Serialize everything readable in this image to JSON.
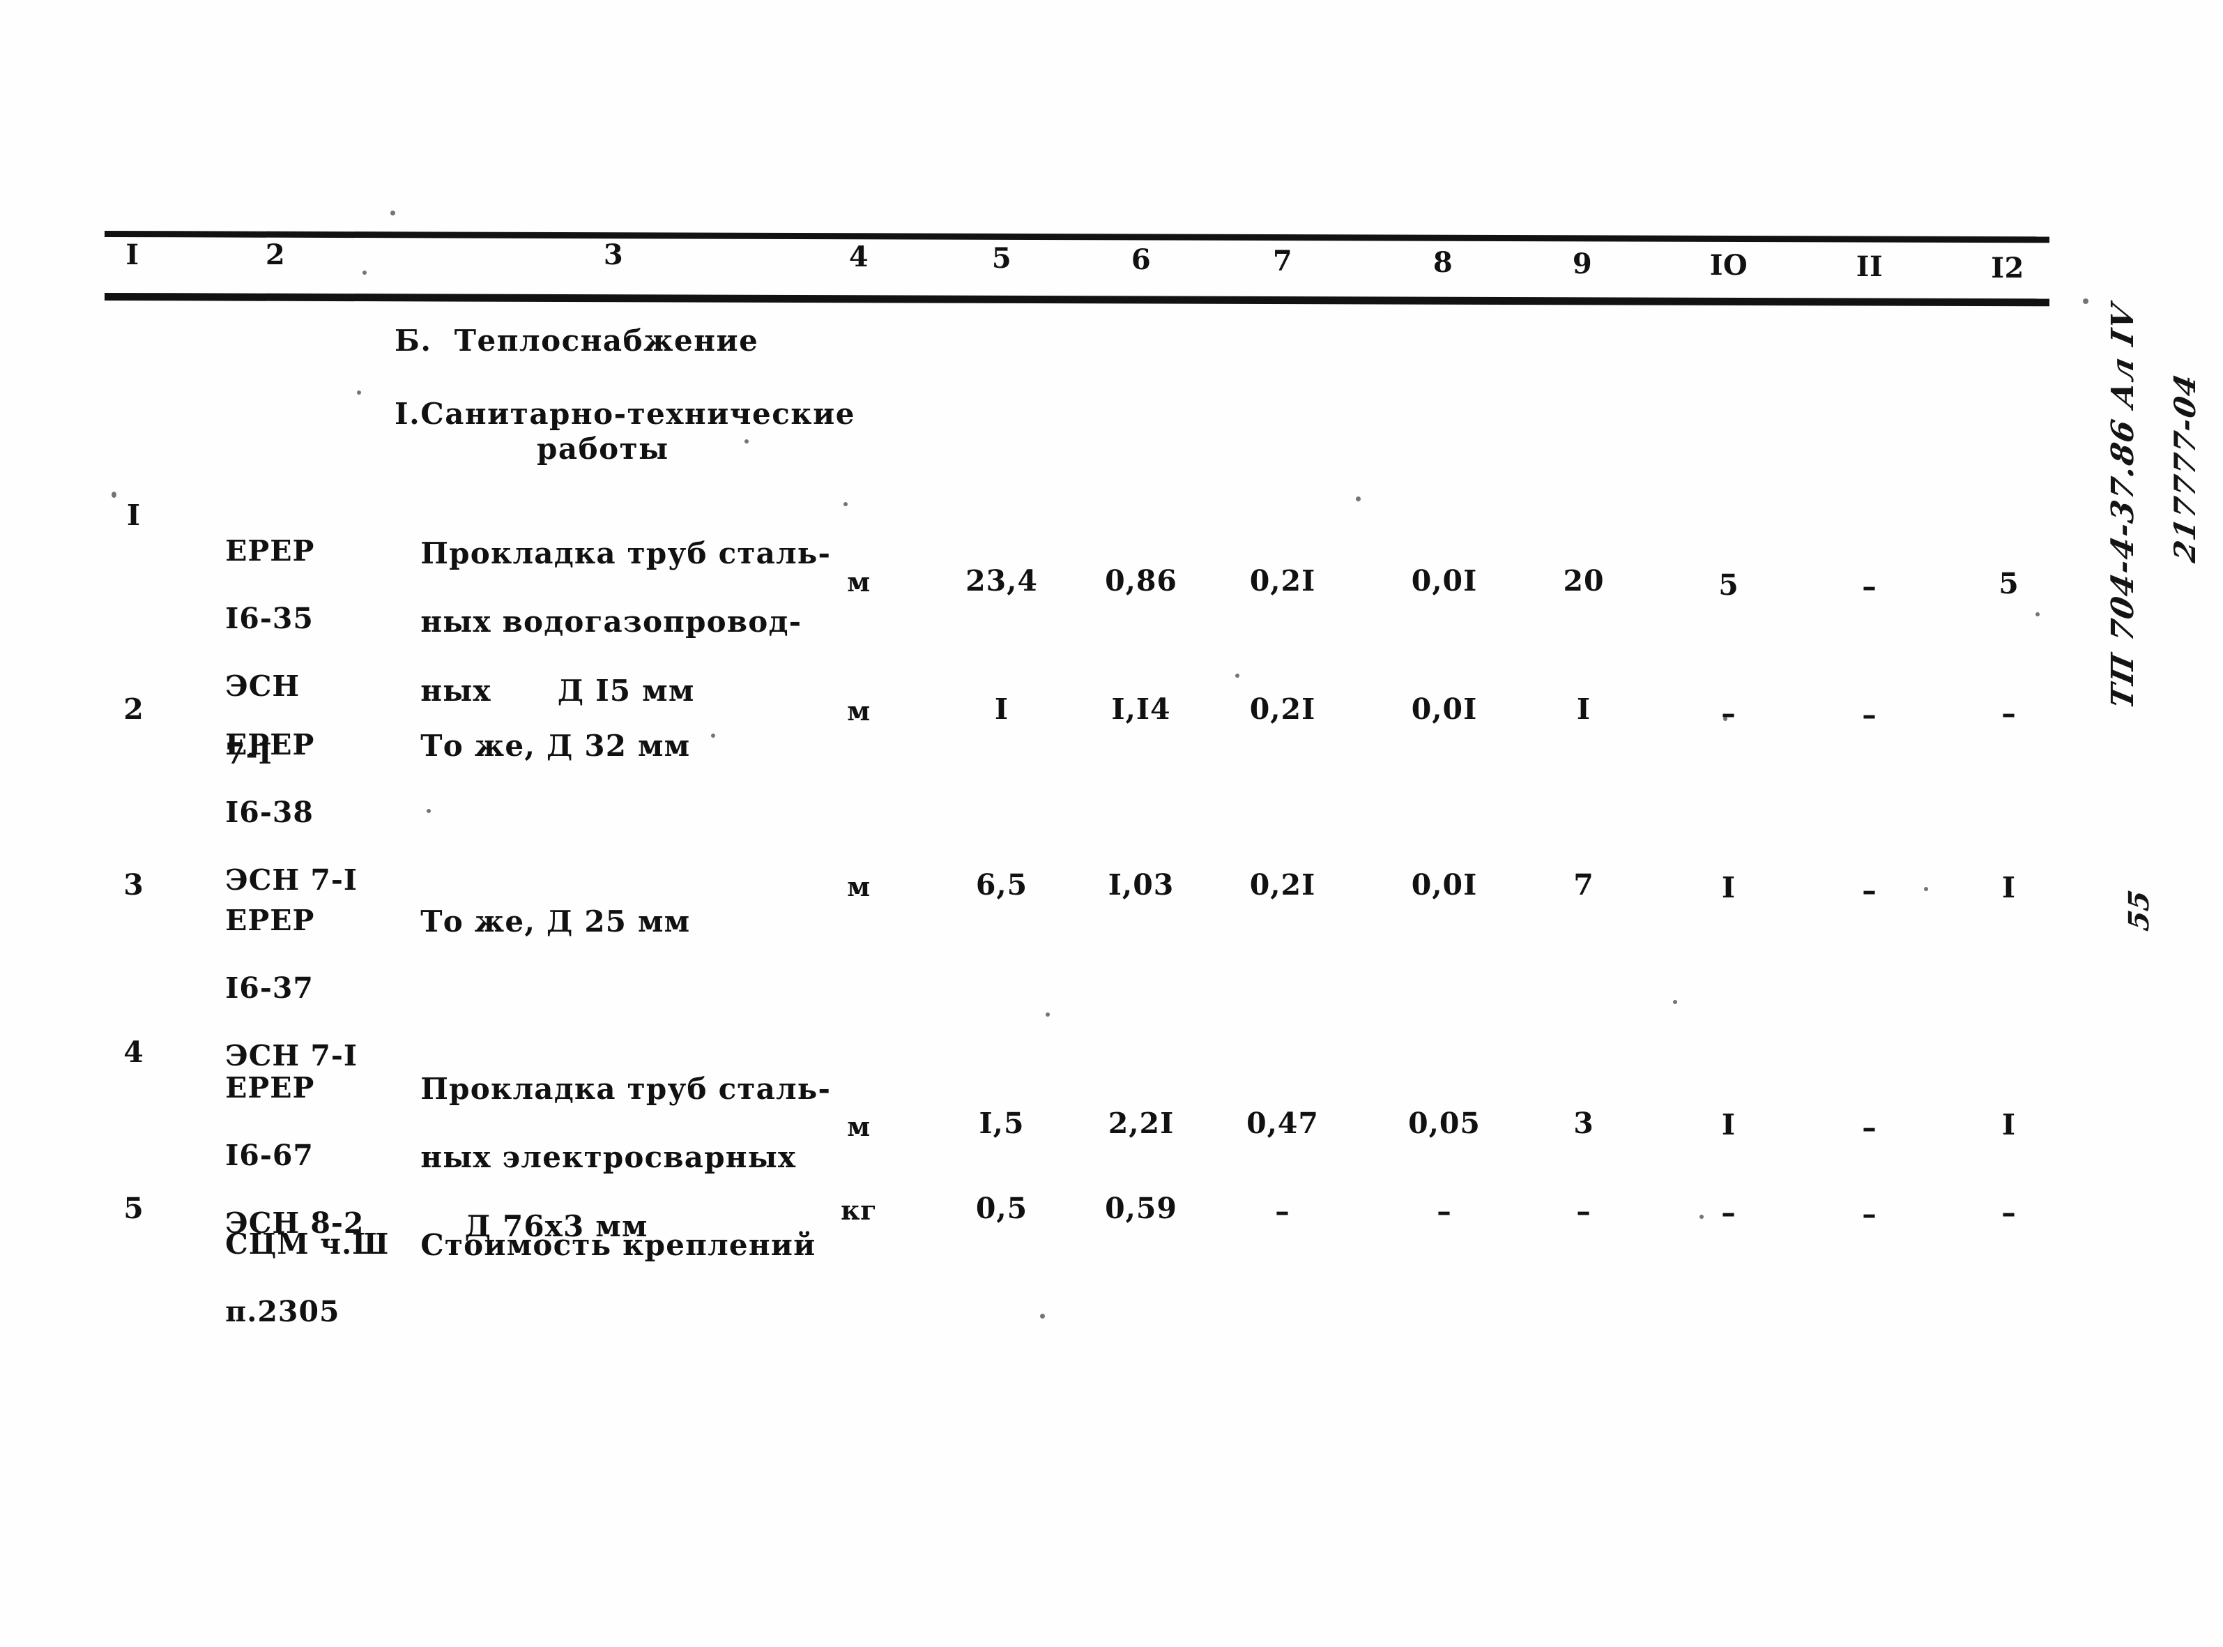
{
  "document": {
    "type": "construction-estimate-table",
    "section_heading": "Б.  Теплоснабжение",
    "subsection_heading": "I.Санитарно-технические",
    "subsection_heading_line2": "работы"
  },
  "table": {
    "column_numbers": [
      "I",
      "2",
      "3",
      "4",
      "5",
      "6",
      "7",
      "8",
      "9",
      "IO",
      "II",
      "I2"
    ],
    "rows": [
      {
        "num": "I",
        "code_lines": [
          "ЕРЕР",
          "I6-35",
          "ЭСН",
          "7-I"
        ],
        "desc_lines": [
          "Прокладка труб сталь-",
          "ных водогазопровод-",
          "ных      Д I5 мм"
        ],
        "unit": "м",
        "c5": "23,4",
        "c6": "0,86",
        "c7": "0,2I",
        "c8": "0,0I",
        "c9": "20",
        "c10": "5",
        "c11": "–",
        "c12": "5"
      },
      {
        "num": "2",
        "code_lines": [
          "ЕРЕР",
          "I6-38",
          "ЭСН 7-I"
        ],
        "desc_lines": [
          "То же, Д 32 мм"
        ],
        "unit": "м",
        "c5": "I",
        "c6": "I,I4",
        "c7": "0,2I",
        "c8": "0,0I",
        "c9": "I",
        "c10": "–",
        "c11": "–",
        "c12": "–"
      },
      {
        "num": "3",
        "code_lines": [
          "ЕРЕР",
          "I6-37",
          "ЭСН 7-I"
        ],
        "desc_lines": [
          "То же, Д 25 мм"
        ],
        "unit": "м",
        "c5": "6,5",
        "c6": "I,03",
        "c7": "0,2I",
        "c8": "0,0I",
        "c9": "7",
        "c10": "I",
        "c11": "–",
        "c12": "I"
      },
      {
        "num": "4",
        "code_lines": [
          "ЕРЕР",
          "I6-67",
          "ЭСН 8-2"
        ],
        "desc_lines": [
          "Прокладка труб сталь-",
          "ных электросварных",
          "    Д 76х3 мм"
        ],
        "unit": "м",
        "c5": "I,5",
        "c6": "2,2I",
        "c7": "0,47",
        "c8": "0,05",
        "c9": "3",
        "c10": "I",
        "c11": "–",
        "c12": "I"
      },
      {
        "num": "5",
        "code_lines": [
          "СЦМ ч.Ш",
          "п.2305"
        ],
        "desc_lines": [
          "Стоимость креплений"
        ],
        "unit": "кг",
        "c5": "0,5",
        "c6": "0,59",
        "c7": "–",
        "c8": "–",
        "c9": "–",
        "c10": "–",
        "c11": "–",
        "c12": "–"
      }
    ]
  },
  "marginalia": {
    "archive_number": "217777-04",
    "project_stamp": "ТП 704-4-37.86 Ал IV",
    "page_number": "55"
  }
}
